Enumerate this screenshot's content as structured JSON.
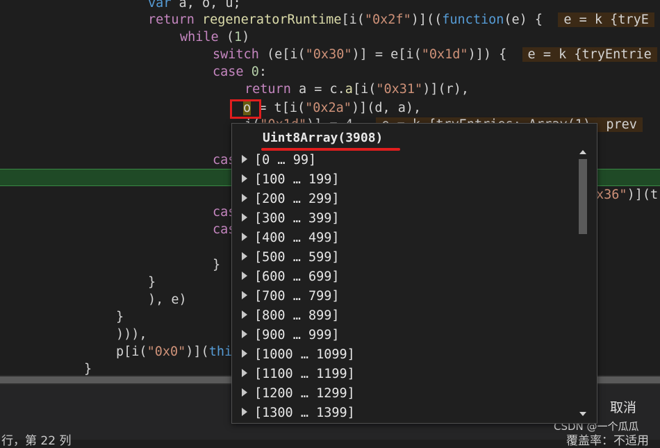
{
  "code_lines": {
    "l0": {
      "kw": "var",
      "rest": " a, o, u;"
    },
    "l1": {
      "kw": "return",
      "fn": "regeneratorRuntime",
      "p1": "[i(",
      "s1": "\"0x2f\"",
      "p2": ")]((",
      "kw2": "function",
      "p3": "(e) {",
      "hint": "e = k {tryE"
    },
    "l2": {
      "kw": "while",
      "p1": " (",
      "n1": "1",
      "p2": ")"
    },
    "l3": {
      "kw": "switch",
      "p1": " (e[i(",
      "s1": "\"0x30\"",
      "p2": ")] = e[i(",
      "s2": "\"0x1d\"",
      "p3": ")]) {",
      "hint": "e = k {tryEntrie"
    },
    "l4": {
      "kw": "case",
      "n1": " 0",
      "p1": ":"
    },
    "l5": {
      "kw": "return",
      "p1": " a = c.",
      "f1": "a",
      "p2": "[i(",
      "s1": "\"0x31\"",
      "p3": ")](r),"
    },
    "l6": {
      "var": "o",
      "p1": " = t[i(",
      "s1": "\"0x2a\"",
      "p2": ")](d, a),"
    },
    "l7": {
      "p1": "i(",
      "s1": "\"0x1d\"",
      "p2": ")] = 4",
      "hint": "e = k {tryEntries: Array(1), prev"
    },
    "l8": {
      "kw": "cas"
    },
    "l10": {
      "s1": "x36\"",
      "p1": ")](t"
    },
    "l11": {
      "kw": "cas"
    },
    "l12": {
      "kw": "cas"
    },
    "l13": {
      "p1": "}"
    },
    "l14": {
      "p1": "}"
    },
    "l15": {
      "p1": "), e)"
    },
    "l16": {
      "p1": "}"
    },
    "l17": {
      "p1": "))),"
    },
    "l18": {
      "p1": "p[i(",
      "s1": "\"0x0\"",
      "p2": ")](",
      "kw": "thi"
    },
    "l19": {
      "p1": "}"
    }
  },
  "popup": {
    "title": "Uint8Array(3908)",
    "ranges": [
      "[0 … 99]",
      "[100 … 199]",
      "[200 … 299]",
      "[300 … 399]",
      "[400 … 499]",
      "[500 … 599]",
      "[600 … 699]",
      "[700 … 799]",
      "[800 … 899]",
      "[900 … 999]",
      "[1000 … 1099]",
      "[1100 … 1199]",
      "[1200 … 1299]",
      "[1300 … 1399]"
    ]
  },
  "footer": {
    "cancel": "取消",
    "status_left": "行，第 22 列",
    "status_right": "覆盖率：不适用",
    "watermark": "CSDN @一个瓜瓜"
  },
  "colors": {
    "keyword": "#569cd6",
    "control": "#c586c0",
    "string": "#ce9178",
    "number": "#b5cea8",
    "function": "#dcdcaa",
    "annotation": "#e01e1e",
    "exec_line": "#1f4a26"
  }
}
